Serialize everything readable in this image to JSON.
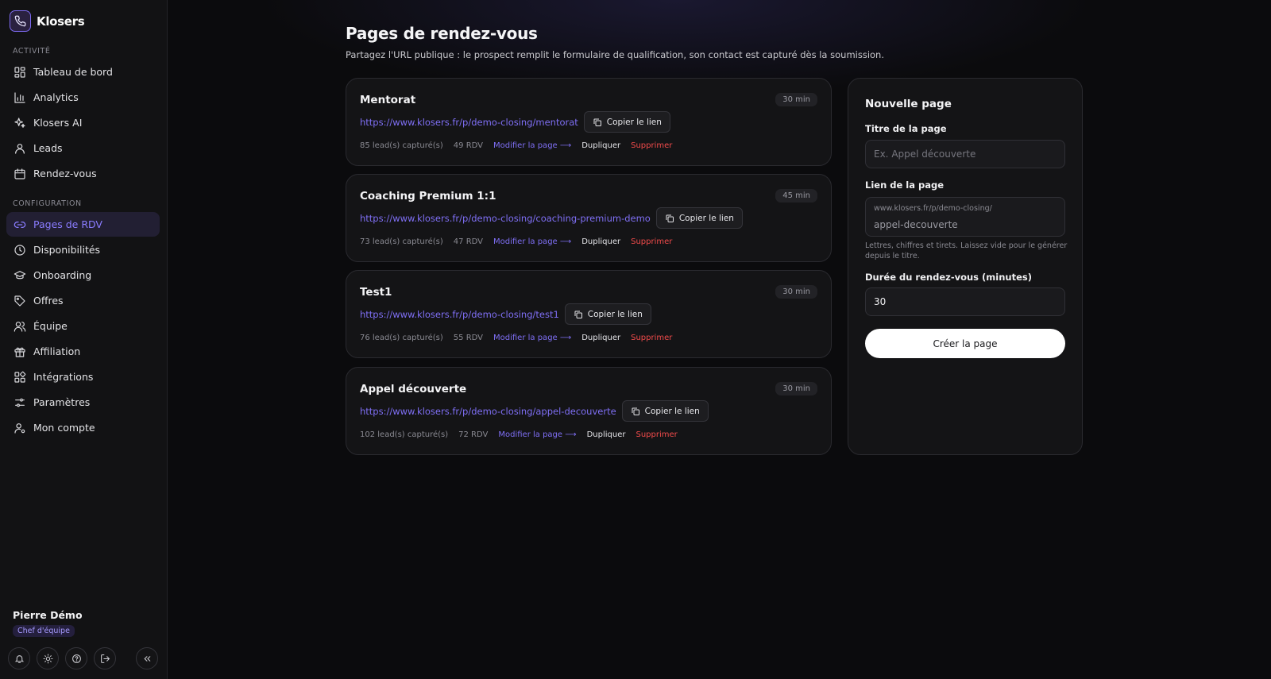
{
  "app": {
    "name": "Klosers",
    "accent": "#7f6ff5"
  },
  "sidebar": {
    "sections": [
      {
        "label": "ACTIVITÉ",
        "items": [
          {
            "label": "Tableau de bord",
            "icon": "dashboard-icon"
          },
          {
            "label": "Analytics",
            "icon": "bar-chart-icon"
          },
          {
            "label": "Klosers AI",
            "icon": "sparkles-icon"
          },
          {
            "label": "Leads",
            "icon": "user-icon"
          },
          {
            "label": "Rendez-vous",
            "icon": "calendar-icon"
          }
        ]
      },
      {
        "label": "CONFIGURATION",
        "items": [
          {
            "label": "Pages de RDV",
            "icon": "link-icon",
            "active": true
          },
          {
            "label": "Disponibilités",
            "icon": "clock-icon"
          },
          {
            "label": "Onboarding",
            "icon": "graduation-cap-icon"
          },
          {
            "label": "Offres",
            "icon": "tag-icon"
          },
          {
            "label": "Équipe",
            "icon": "users-icon"
          },
          {
            "label": "Affiliation",
            "icon": "gift-icon"
          },
          {
            "label": "Intégrations",
            "icon": "puzzle-icon"
          },
          {
            "label": "Paramètres",
            "icon": "sliders-icon"
          },
          {
            "label": "Mon compte",
            "icon": "user-cog-icon"
          }
        ]
      }
    ],
    "user": {
      "name": "Pierre Démo",
      "role": "Chef d'équipe"
    },
    "footer_icons": [
      "bell-icon",
      "sun-icon",
      "help-icon",
      "logout-icon"
    ],
    "collapse_icon": "chevrons-left-icon"
  },
  "main": {
    "title": "Pages de rendez-vous",
    "subtitle": "Partagez l'URL publique : le prospect remplit le formulaire de qualification, son contact est capturé dès la soumission.",
    "pages": [
      {
        "title": "Mentorat",
        "duration": "30 min",
        "url": "https://www.klosers.fr/p/demo-closing/mentorat",
        "copy_label": "Copier le lien",
        "leads": "85 lead(s) capturé(s)",
        "rdv": "49 RDV",
        "edit_label": "Modifier la page ⟶",
        "duplicate_label": "Dupliquer",
        "delete_label": "Supprimer"
      },
      {
        "title": "Coaching Premium 1:1",
        "duration": "45 min",
        "url": "https://www.klosers.fr/p/demo-closing/coaching-premium-demo",
        "copy_label": "Copier le lien",
        "leads": "73 lead(s) capturé(s)",
        "rdv": "47 RDV",
        "edit_label": "Modifier la page ⟶",
        "duplicate_label": "Dupliquer",
        "delete_label": "Supprimer"
      },
      {
        "title": "Test1",
        "duration": "30 min",
        "url": "https://www.klosers.fr/p/demo-closing/test1",
        "copy_label": "Copier le lien",
        "leads": "76 lead(s) capturé(s)",
        "rdv": "55 RDV",
        "edit_label": "Modifier la page ⟶",
        "duplicate_label": "Dupliquer",
        "delete_label": "Supprimer"
      },
      {
        "title": "Appel découverte",
        "duration": "30 min",
        "url": "https://www.klosers.fr/p/demo-closing/appel-decouverte",
        "copy_label": "Copier le lien",
        "leads": "102 lead(s) capturé(s)",
        "rdv": "72 RDV",
        "edit_label": "Modifier la page ⟶",
        "duplicate_label": "Dupliquer",
        "delete_label": "Supprimer"
      }
    ]
  },
  "form": {
    "title": "Nouvelle page",
    "title_label": "Titre de la page",
    "title_placeholder": "Ex. Appel découverte",
    "slug_label": "Lien de la page",
    "slug_prefix": "www.klosers.fr/p/demo-closing/",
    "slug_placeholder": "appel-decouverte",
    "slug_hint": "Lettres, chiffres et tirets. Laissez vide pour le générer depuis le titre.",
    "duration_label": "Durée du rendez-vous (minutes)",
    "duration_value": "30",
    "submit_label": "Créer la page"
  }
}
